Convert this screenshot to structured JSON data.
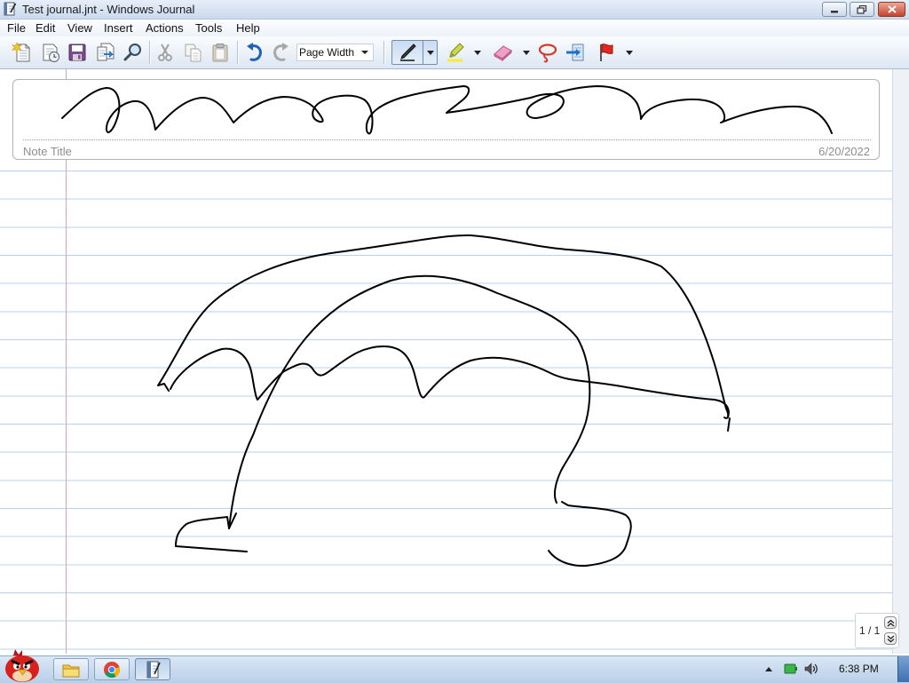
{
  "window": {
    "title": "Test journal.jnt - Windows Journal"
  },
  "menu": [
    "File",
    "Edit",
    "View",
    "Insert",
    "Actions",
    "Tools",
    "Help"
  ],
  "toolbar": {
    "zoom": "Page Width"
  },
  "note": {
    "title_placeholder": "Note Title",
    "date": "6/20/2022"
  },
  "pager": {
    "label": "1 / 1"
  },
  "taskbar": {
    "clock": "6:38 PM"
  },
  "colors": {
    "ink": "#000000",
    "rule_line": "#b9d1ec",
    "margin_line": "#c9a6c9",
    "title_bar": "#cbdaed",
    "close_button": "#c5442d"
  }
}
